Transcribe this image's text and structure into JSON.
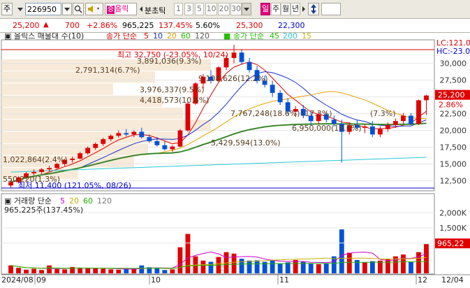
{
  "toolbar": {
    "market_label": "주",
    "code": "226950",
    "name_label": "올릭",
    "mode_label": "분초틱",
    "periods": [
      "1",
      "3",
      "5",
      "10",
      "20",
      "30"
    ],
    "period_selected": "30",
    "day_label": "일",
    "week_label": "주",
    "month_label": "월",
    "year_label": "년"
  },
  "quote": {
    "price": "25,200",
    "change": "700",
    "change_pct": "+2.86%",
    "volume": "965,225",
    "volume_ratio": "137.45%",
    "turnover": "5.60%",
    "high": "25,300",
    "low": "22,300"
  },
  "price_panel": {
    "legend_title": "올릭스 매물대 수(10)",
    "ma_label": "종가 단순",
    "ma_periods": [
      "5",
      "10",
      "20",
      "60",
      "120"
    ],
    "ma2_label": "종가 단순",
    "ma2_periods": [
      "45",
      "200",
      "15"
    ],
    "y_ticks": [
      "30,000",
      "27,500",
      "25,000",
      "22,500",
      "20,000",
      "17,500",
      "15,000",
      "12,500"
    ],
    "right_labels": {
      "lc": "LC:121.0",
      "hc": "HC:-23.0",
      "current": "25,200",
      "pct": "2.86%"
    },
    "annotations": {
      "high": "최고 32,750 (-23.05%, 10/24)",
      "low": "최저 11,400 (121.05%, 08/26)",
      "profile": [
        "3,891,036(9.3%)",
        "2,791,314(6.7%)",
        "9,108,626(12.2%)",
        "3,976,337(9.5%)",
        "4,418,573(10.6%)",
        "7,767,248(18.6%)",
        "(17.3%)",
        "(7.3%)",
        "6,950,000(16.6%)",
        "5,429,594(13.0%)",
        "1,022,864(2.4%)",
        "550,220(1.3%)"
      ]
    }
  },
  "volume_panel": {
    "legend_title": "거래량 단순",
    "ma_periods": [
      "5",
      "20",
      "60",
      "120"
    ],
    "volume_text": "965,225주(137.45%)",
    "y_ticks": [
      "2,000K",
      "1,500K",
      "1,000K"
    ],
    "current_label": "965,22"
  },
  "x_axis": {
    "labels": [
      "2024/08",
      "09",
      "10",
      "11",
      "12",
      "12/04"
    ]
  },
  "chart_data": {
    "type": "candlestick",
    "ylim": [
      11000,
      33500
    ],
    "series": [
      {
        "name": "price",
        "values": [
          [
            11800,
            12600,
            11400,
            12300
          ],
          [
            12300,
            13200,
            12100,
            13000
          ],
          [
            13000,
            13800,
            12700,
            13600
          ],
          [
            13600,
            14200,
            13300,
            13800
          ],
          [
            13800,
            14400,
            13500,
            14200
          ],
          [
            14200,
            14700,
            13900,
            14400
          ],
          [
            14400,
            15200,
            14300,
            15000
          ],
          [
            15000,
            15800,
            14700,
            15600
          ],
          [
            15600,
            16100,
            15200,
            15800
          ],
          [
            15800,
            16800,
            15700,
            16600
          ],
          [
            16600,
            17600,
            16400,
            17400
          ],
          [
            17400,
            18200,
            17100,
            18000
          ],
          [
            18000,
            18900,
            17700,
            18700
          ],
          [
            18700,
            19400,
            18400,
            19200
          ],
          [
            19200,
            20000,
            18900,
            19600
          ],
          [
            19600,
            20200,
            19100,
            19400
          ],
          [
            19400,
            20000,
            19000,
            19800
          ],
          [
            19800,
            20400,
            18800,
            19000
          ],
          [
            19000,
            19400,
            18200,
            18400
          ],
          [
            18400,
            19000,
            17600,
            17800
          ],
          [
            17800,
            18400,
            17000,
            17200
          ],
          [
            17200,
            17800,
            16800,
            17600
          ],
          [
            17600,
            20200,
            17500,
            20000
          ],
          [
            20000,
            24200,
            19800,
            24000
          ],
          [
            24000,
            27200,
            23800,
            27000
          ],
          [
            27000,
            28400,
            26200,
            28000
          ],
          [
            28000,
            29000,
            27000,
            27400
          ],
          [
            27400,
            29600,
            27200,
            29400
          ],
          [
            29400,
            31200,
            29000,
            30800
          ],
          [
            30800,
            32750,
            30000,
            31600
          ],
          [
            31600,
            32000,
            29800,
            30200
          ],
          [
            30200,
            30800,
            28600,
            29000
          ],
          [
            29000,
            29600,
            27000,
            27400
          ],
          [
            27400,
            28200,
            26400,
            26800
          ],
          [
            26800,
            27400,
            25000,
            25600
          ],
          [
            25600,
            26000,
            23800,
            24200
          ],
          [
            24200,
            24800,
            22400,
            22800
          ],
          [
            22800,
            23600,
            22000,
            23200
          ],
          [
            23200,
            23800,
            21800,
            22200
          ],
          [
            22200,
            22800,
            20800,
            21400
          ],
          [
            21400,
            22800,
            21000,
            22400
          ],
          [
            22400,
            22800,
            21200,
            21600
          ],
          [
            21600,
            22200,
            20600,
            21000
          ],
          [
            21000,
            21600,
            15200,
            19800
          ],
          [
            19800,
            21200,
            19400,
            20800
          ],
          [
            20800,
            21600,
            20200,
            20400
          ],
          [
            20400,
            21000,
            19600,
            20600
          ],
          [
            20600,
            21400,
            19000,
            19400
          ],
          [
            19400,
            20600,
            19000,
            20200
          ],
          [
            20200,
            21200,
            19800,
            20800
          ],
          [
            20800,
            21800,
            20400,
            21400
          ],
          [
            21400,
            22600,
            21000,
            22200
          ],
          [
            22200,
            22600,
            20800,
            21000
          ],
          [
            21000,
            24600,
            20800,
            24500
          ],
          [
            24500,
            25300,
            22300,
            25200
          ]
        ]
      },
      {
        "name": "volume_k",
        "values": [
          260,
          180,
          120,
          150,
          110,
          260,
          140,
          130,
          210,
          160,
          180,
          170,
          150,
          130,
          120,
          140,
          150,
          260,
          200,
          160,
          110,
          130,
          860,
          1300,
          560,
          420,
          380,
          540,
          700,
          650,
          480,
          420,
          430,
          380,
          450,
          320,
          360,
          440,
          380,
          320,
          300,
          330,
          560,
          1450,
          680,
          440,
          360,
          400,
          420,
          480,
          560,
          620,
          380,
          700,
          965
        ]
      }
    ]
  }
}
